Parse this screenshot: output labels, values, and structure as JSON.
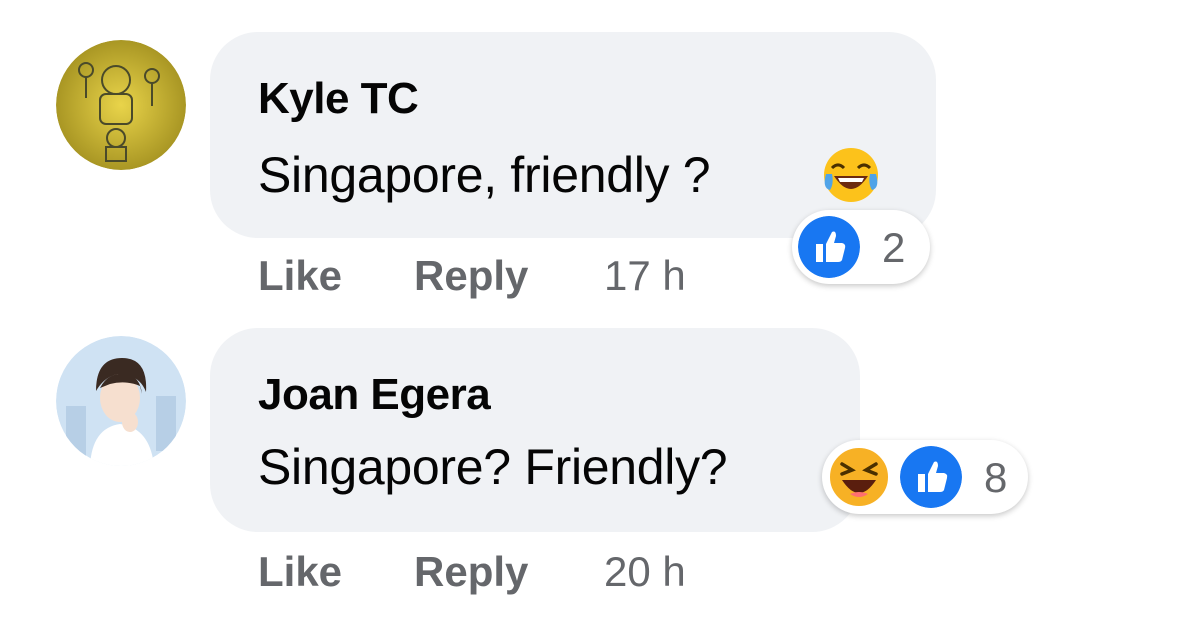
{
  "comments": [
    {
      "author": "Kyle TC",
      "text": "Singapore, friendly ?",
      "inline_emoji": "tears-of-joy-emoji",
      "actions": {
        "like": "Like",
        "reply": "Reply",
        "time": "17 h"
      },
      "reactions": {
        "icons": [
          "like-icon"
        ],
        "count": "2"
      }
    },
    {
      "author": "Joan Egera",
      "text": "Singapore? Friendly?",
      "actions": {
        "like": "Like",
        "reply": "Reply",
        "time": "20 h"
      },
      "reactions": {
        "icons": [
          "haha-icon",
          "like-icon"
        ],
        "count": "8"
      }
    }
  ],
  "colors": {
    "bubble": "#f0f2f5",
    "meta_text": "#65676b",
    "like_blue": "#1877f2",
    "haha_yellow": "#f7b125"
  }
}
